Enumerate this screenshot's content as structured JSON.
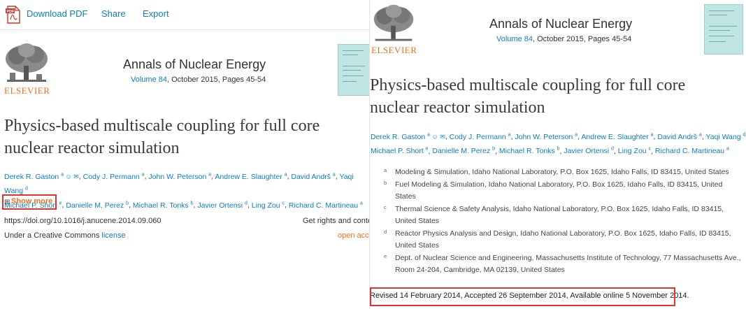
{
  "toolbar": {
    "download_pdf": "Download PDF",
    "share": "Share",
    "export": "Export",
    "pdf_icon_text": "PDF"
  },
  "journal": {
    "publisher": "ELSEVIER",
    "title": "Annals of Nuclear Energy",
    "volume_link": "Volume 84",
    "issue_rest": ", October 2015, Pages 45-54"
  },
  "article": {
    "title_line1": "Physics-based multiscale coupling for full core",
    "title_line2": "nuclear reactor simulation"
  },
  "authors_left": {
    "line1": [
      {
        "name": "Derek R. Gaston",
        "sup": "a"
      },
      {
        "name": "Cody J. Permann",
        "sup": "a"
      },
      {
        "name": "John W. Peterson",
        "sup": "a"
      },
      {
        "name": "Andrew E. Slaughter",
        "sup": "a"
      },
      {
        "name": "David Andrš",
        "sup": "a"
      },
      {
        "name": "Yaqi Wang",
        "sup": "d"
      }
    ],
    "line2": [
      {
        "name": "Michael P. Short",
        "sup": "e"
      },
      {
        "name": "Danielle M. Perez",
        "sup": "b"
      },
      {
        "name": "Michael R. Tonks",
        "sup": "b"
      },
      {
        "name": "Javier Ortensi",
        "sup": "d"
      },
      {
        "name": "Ling Zou",
        "sup": "c"
      },
      {
        "name": "Richard C. Martineau",
        "sup": "a"
      }
    ]
  },
  "authors_right": {
    "line1": [
      {
        "name": "Derek R. Gaston",
        "sup": "a"
      },
      {
        "name": "Cody J. Permann",
        "sup": "a"
      },
      {
        "name": "John W. Peterson",
        "sup": "a"
      },
      {
        "name": "Andrew E. Slaughter",
        "sup": "a"
      },
      {
        "name": "David Andrš",
        "sup": "a"
      },
      {
        "name": "Yaqi Wang",
        "sup": "d"
      }
    ],
    "line2": [
      {
        "name": "Michael P. Short",
        "sup": "e"
      },
      {
        "name": "Danielle M. Perez",
        "sup": "b"
      },
      {
        "name": "Michael R. Tonks",
        "sup": "b"
      },
      {
        "name": "Javier Ortensi",
        "sup": "d"
      },
      {
        "name": "Ling Zou",
        "sup": "c"
      },
      {
        "name": "Richard C. Martineau",
        "sup": "a"
      }
    ]
  },
  "show_more": "Show more",
  "doi": "https://doi.org/10.1016/j.anucene.2014.09.060",
  "rights": "Get rights and conte",
  "license_prefix": "Under a Creative Commons ",
  "license_link": "license",
  "open_access": "open acce",
  "affiliations": [
    {
      "label": "a",
      "text": "Modeling & Simulation, Idaho National Laboratory, P.O. Box 1625, Idaho Falls, ID 83415, United States"
    },
    {
      "label": "b",
      "text": "Fuel Modeling & Simulation, Idaho National Laboratory, P.O. Box 1625, Idaho Falls, ID 83415, United States"
    },
    {
      "label": "c",
      "text": "Thermal Science & Safety Analysis, Idaho National Laboratory, P.O. Box 1625, Idaho Falls, ID 83415, United States"
    },
    {
      "label": "d",
      "text": "Reactor Physics Analysis and Design, Idaho National Laboratory, P.O. Box 1625, Idaho Falls, ID 83415, United States"
    },
    {
      "label": "e",
      "text": "Dept. of Nuclear Science and Engineering, Massachusetts Institute of Technology, 77 Massachusetts Ave., Room 24-204, Cambridge, MA 02139, United States"
    }
  ],
  "history": "Revised 14 February 2014, Accepted 26 September 2014, Available online 5 November 2014.",
  "colors": {
    "link": "#0c7dbb",
    "elsevier_orange": "#e9711c",
    "highlight_red": "#d9362f",
    "cover_teal": "#bfe6e4"
  }
}
